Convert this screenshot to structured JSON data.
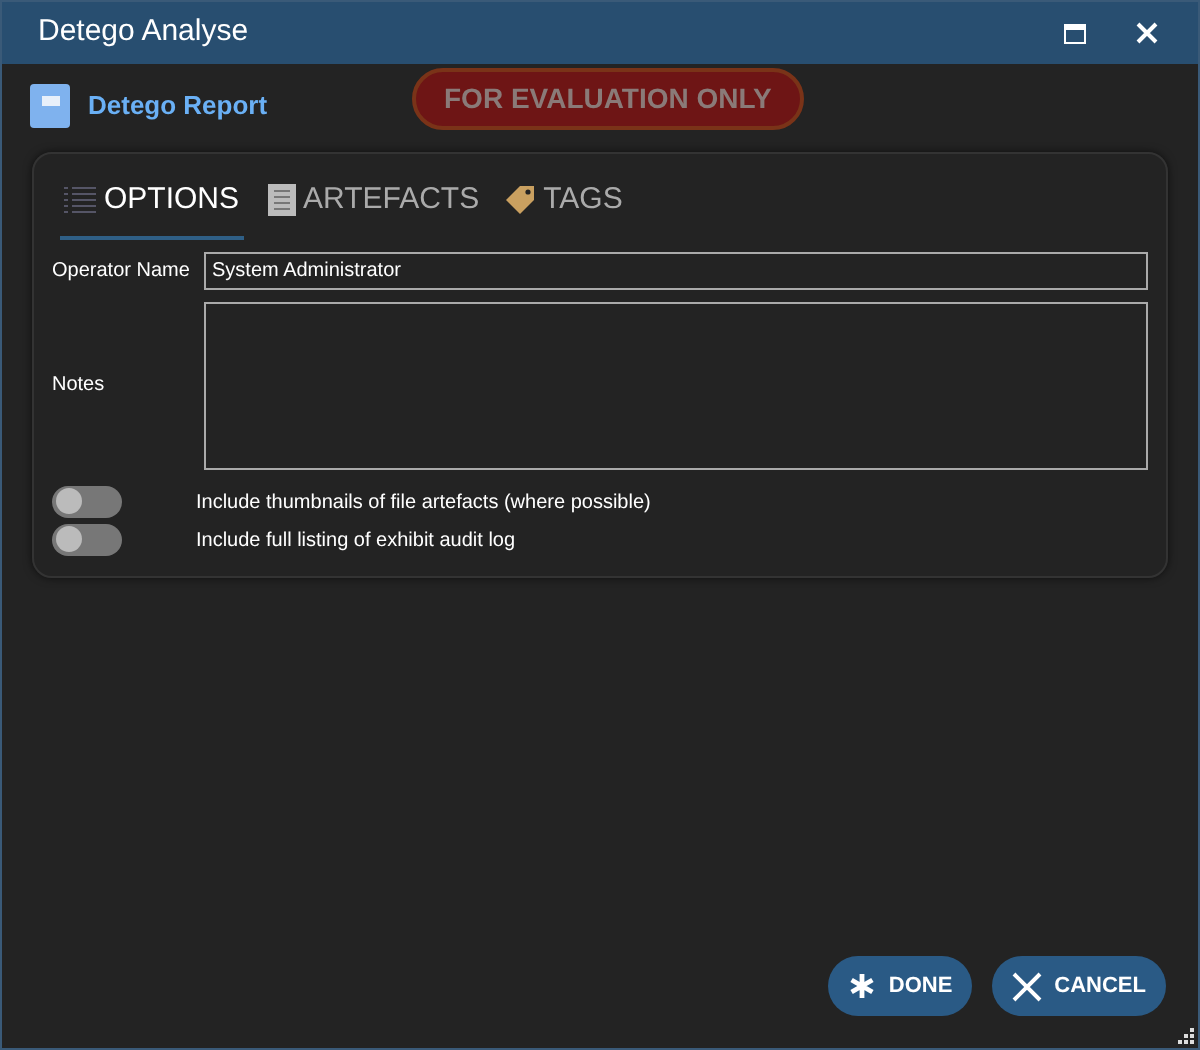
{
  "window": {
    "title": "Detego Analyse"
  },
  "header": {
    "title": "Detego Report",
    "badge": "FOR EVALUATION ONLY"
  },
  "tabs": [
    {
      "label": "OPTIONS",
      "kind": "list",
      "selected": true
    },
    {
      "label": "ARTEFACTS",
      "kind": "document",
      "selected": false
    },
    {
      "label": "TAGS",
      "kind": "tag",
      "selected": false
    }
  ],
  "fields": [
    {
      "label": "Operator Name",
      "kind": "text",
      "value": "System Administrator"
    },
    {
      "label": "Notes",
      "kind": "multiline"
    }
  ],
  "toggles": [
    {
      "label": "Include thumbnails of file artefacts (where possible)",
      "on": false
    },
    {
      "label": "Include full listing of exhibit audit log",
      "on": false
    }
  ],
  "buttons": [
    {
      "label": "DONE",
      "kind": "done"
    },
    {
      "label": "CANCEL",
      "kind": "cancel"
    }
  ]
}
